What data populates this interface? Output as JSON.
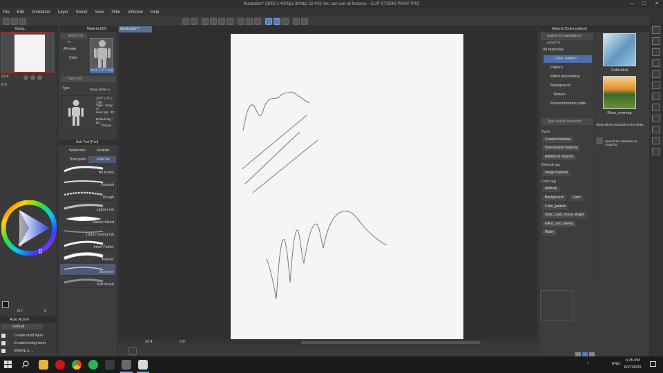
{
  "window": {
    "title": "Illustration* (3000 x 4000px 300dpi 22.4%)  You can use all features - CLIP STUDIO PAINT PRO",
    "min_label": "—",
    "max_label": "☐",
    "close_label": "✕"
  },
  "menu": [
    "File",
    "Edit",
    "Animation",
    "Layer",
    "Select",
    "View",
    "Filter",
    "Window",
    "Help"
  ],
  "navigator": {
    "tab1": "Navig...",
    "zoom": "22.4",
    "rotate": "0.0"
  },
  "material_small": {
    "tab": "Material [3D/",
    "search_placeholder": "Search for m",
    "all_materials": "All mate",
    "color_item": "Color",
    "figure_label": "3Dデッサン人形",
    "type_label": "Type",
    "show_all": "Show all the m",
    "search2_placeholder": "Type sea",
    "info_name": "3Dデッサン人形",
    "info_type": "Type : Body m",
    "info_usertag": "User tag : 3D",
    "info_default": "Default tag : Bo",
    "info_toning": "Toning"
  },
  "subtool": {
    "tab": "Sub Tool [Pen]",
    "tabs": [
      "Watercolor",
      "Realistic",
      "Thick paint",
      "India ink"
    ],
    "brushes": [
      "Bit husky",
      "Smooth",
      "Rough",
      "Lighter ink",
      "Darker bleed",
      "Light running ink",
      "Inker Flatter",
      "Painter",
      "Sketcher",
      "Soft brush"
    ],
    "selected_brush": "Sketcher"
  },
  "color": {
    "size": "217",
    "opacity": "0",
    "main": "#1a1a1a"
  },
  "auto_action": {
    "title": "Auto Action",
    "set": "Default",
    "items": [
      "Create draft layer",
      "Create toning layer",
      "Making a ..."
    ]
  },
  "canvas": {
    "tab": "Illustration*",
    "zoom": "22.4",
    "rotate": "0.0"
  },
  "material_panel": {
    "header": "Material [Color pattern]",
    "search_placeholder": "Search for materials on ASSETS",
    "tree": [
      "All materials",
      "Color pattern",
      "Pattern",
      "Effect and feeling",
      "Background",
      "Texture",
      "Monochromatic patte"
    ],
    "selected": "Color pattern",
    "keyword_placeholder": "Type search keywords",
    "type_header": "Type",
    "type_tags": [
      "Created material",
      "Downloaded material",
      "Additional material"
    ],
    "default_tag_header": "Default tag",
    "default_tags": [
      "Image material"
    ],
    "user_tag_header": "User tag",
    "user_tags": [
      "Artificial",
      "Background",
      "Color",
      "Color_pattern",
      "Dark_Loud_Tense_Anger",
      "Effect_and_feeling",
      "Water"
    ],
    "thumbs": [
      {
        "label": "Cold wind",
        "color": "#6f9bbd"
      },
      {
        "label": "River_evening",
        "color": "#c07a2a"
      }
    ],
    "show_all_text": "Show all the materials in the folder.",
    "assets_text": "Search for materials on ASSETS"
  },
  "taskbar": {
    "time": "6:35 PM",
    "date": "8/27/2020",
    "lang": "ENG"
  }
}
